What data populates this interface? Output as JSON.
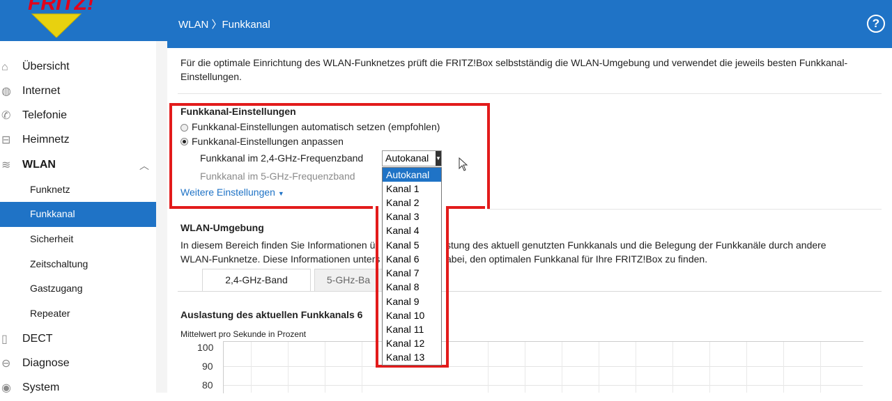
{
  "header": {
    "breadcrumb": "WLAN 〉Funkkanal",
    "help": "?",
    "logo": "FRITZ!"
  },
  "sidebar": {
    "items": [
      {
        "label": "Übersicht",
        "icon": "home-icon"
      },
      {
        "label": "Internet",
        "icon": "globe-icon"
      },
      {
        "label": "Telefonie",
        "icon": "phone-icon"
      },
      {
        "label": "Heimnetz",
        "icon": "network-icon"
      },
      {
        "label": "WLAN",
        "icon": "wifi-icon"
      },
      {
        "label": "DECT",
        "icon": "dect-phone-icon"
      },
      {
        "label": "Diagnose",
        "icon": "diagnose-icon"
      },
      {
        "label": "System",
        "icon": "system-icon"
      }
    ],
    "wlan_sub": [
      "Funknetz",
      "Funkkanal",
      "Sicherheit",
      "Zeitschaltung",
      "Gastzugang",
      "Repeater"
    ]
  },
  "main": {
    "intro": "Für die optimale Einrichtung des WLAN-Funknetzes prüft die FRITZ!Box selbstständig die WLAN-Umgebung und verwendet die jeweils besten Funkkanal-Einstellungen.",
    "settings_title": "Funkkanal-Einstellungen",
    "radio_auto": "Funkkanal-Einstellungen automatisch setzen (empfohlen)",
    "radio_custom": "Funkkanal-Einstellungen anpassen",
    "band24_label": "Funkkanal im 2,4-GHz-Frequenzband",
    "band5_label": "Funkkanal im 5-GHz-Frequenzband",
    "select_value": "Autokanal",
    "options": [
      "Autokanal",
      "Kanal 1",
      "Kanal 2",
      "Kanal 3",
      "Kanal 4",
      "Kanal 5",
      "Kanal 6",
      "Kanal 7",
      "Kanal 8",
      "Kanal 9",
      "Kanal 10",
      "Kanal 11",
      "Kanal 12",
      "Kanal 13"
    ],
    "more_link": "Weitere Einstellungen",
    "env_title": "WLAN-Umgebung",
    "env_text_1a": "In diesem Bereich finden Sie Informationen ü",
    "env_text_1b": "stung des aktuell genutzten Funkkanals und die Belegung der Funkkanäle durch andere",
    "env_text_2a": "WLAN-Funknetze. Diese Informationen unters",
    "env_text_2b": "abei, den optimalen Funkkanal für Ihre FRITZ!Box zu finden.",
    "tab_24": "2,4-GHz-Band",
    "tab_5": "5-GHz-Ba",
    "load_title": "Auslastung des aktuellen Funkkanals 6",
    "chart_caption": "Mittelwert pro Sekunde in Prozent",
    "yticks": [
      "100",
      "90",
      "80"
    ]
  },
  "colors": {
    "brand_blue": "#1f73c6",
    "highlight_red": "#e21b1b"
  }
}
